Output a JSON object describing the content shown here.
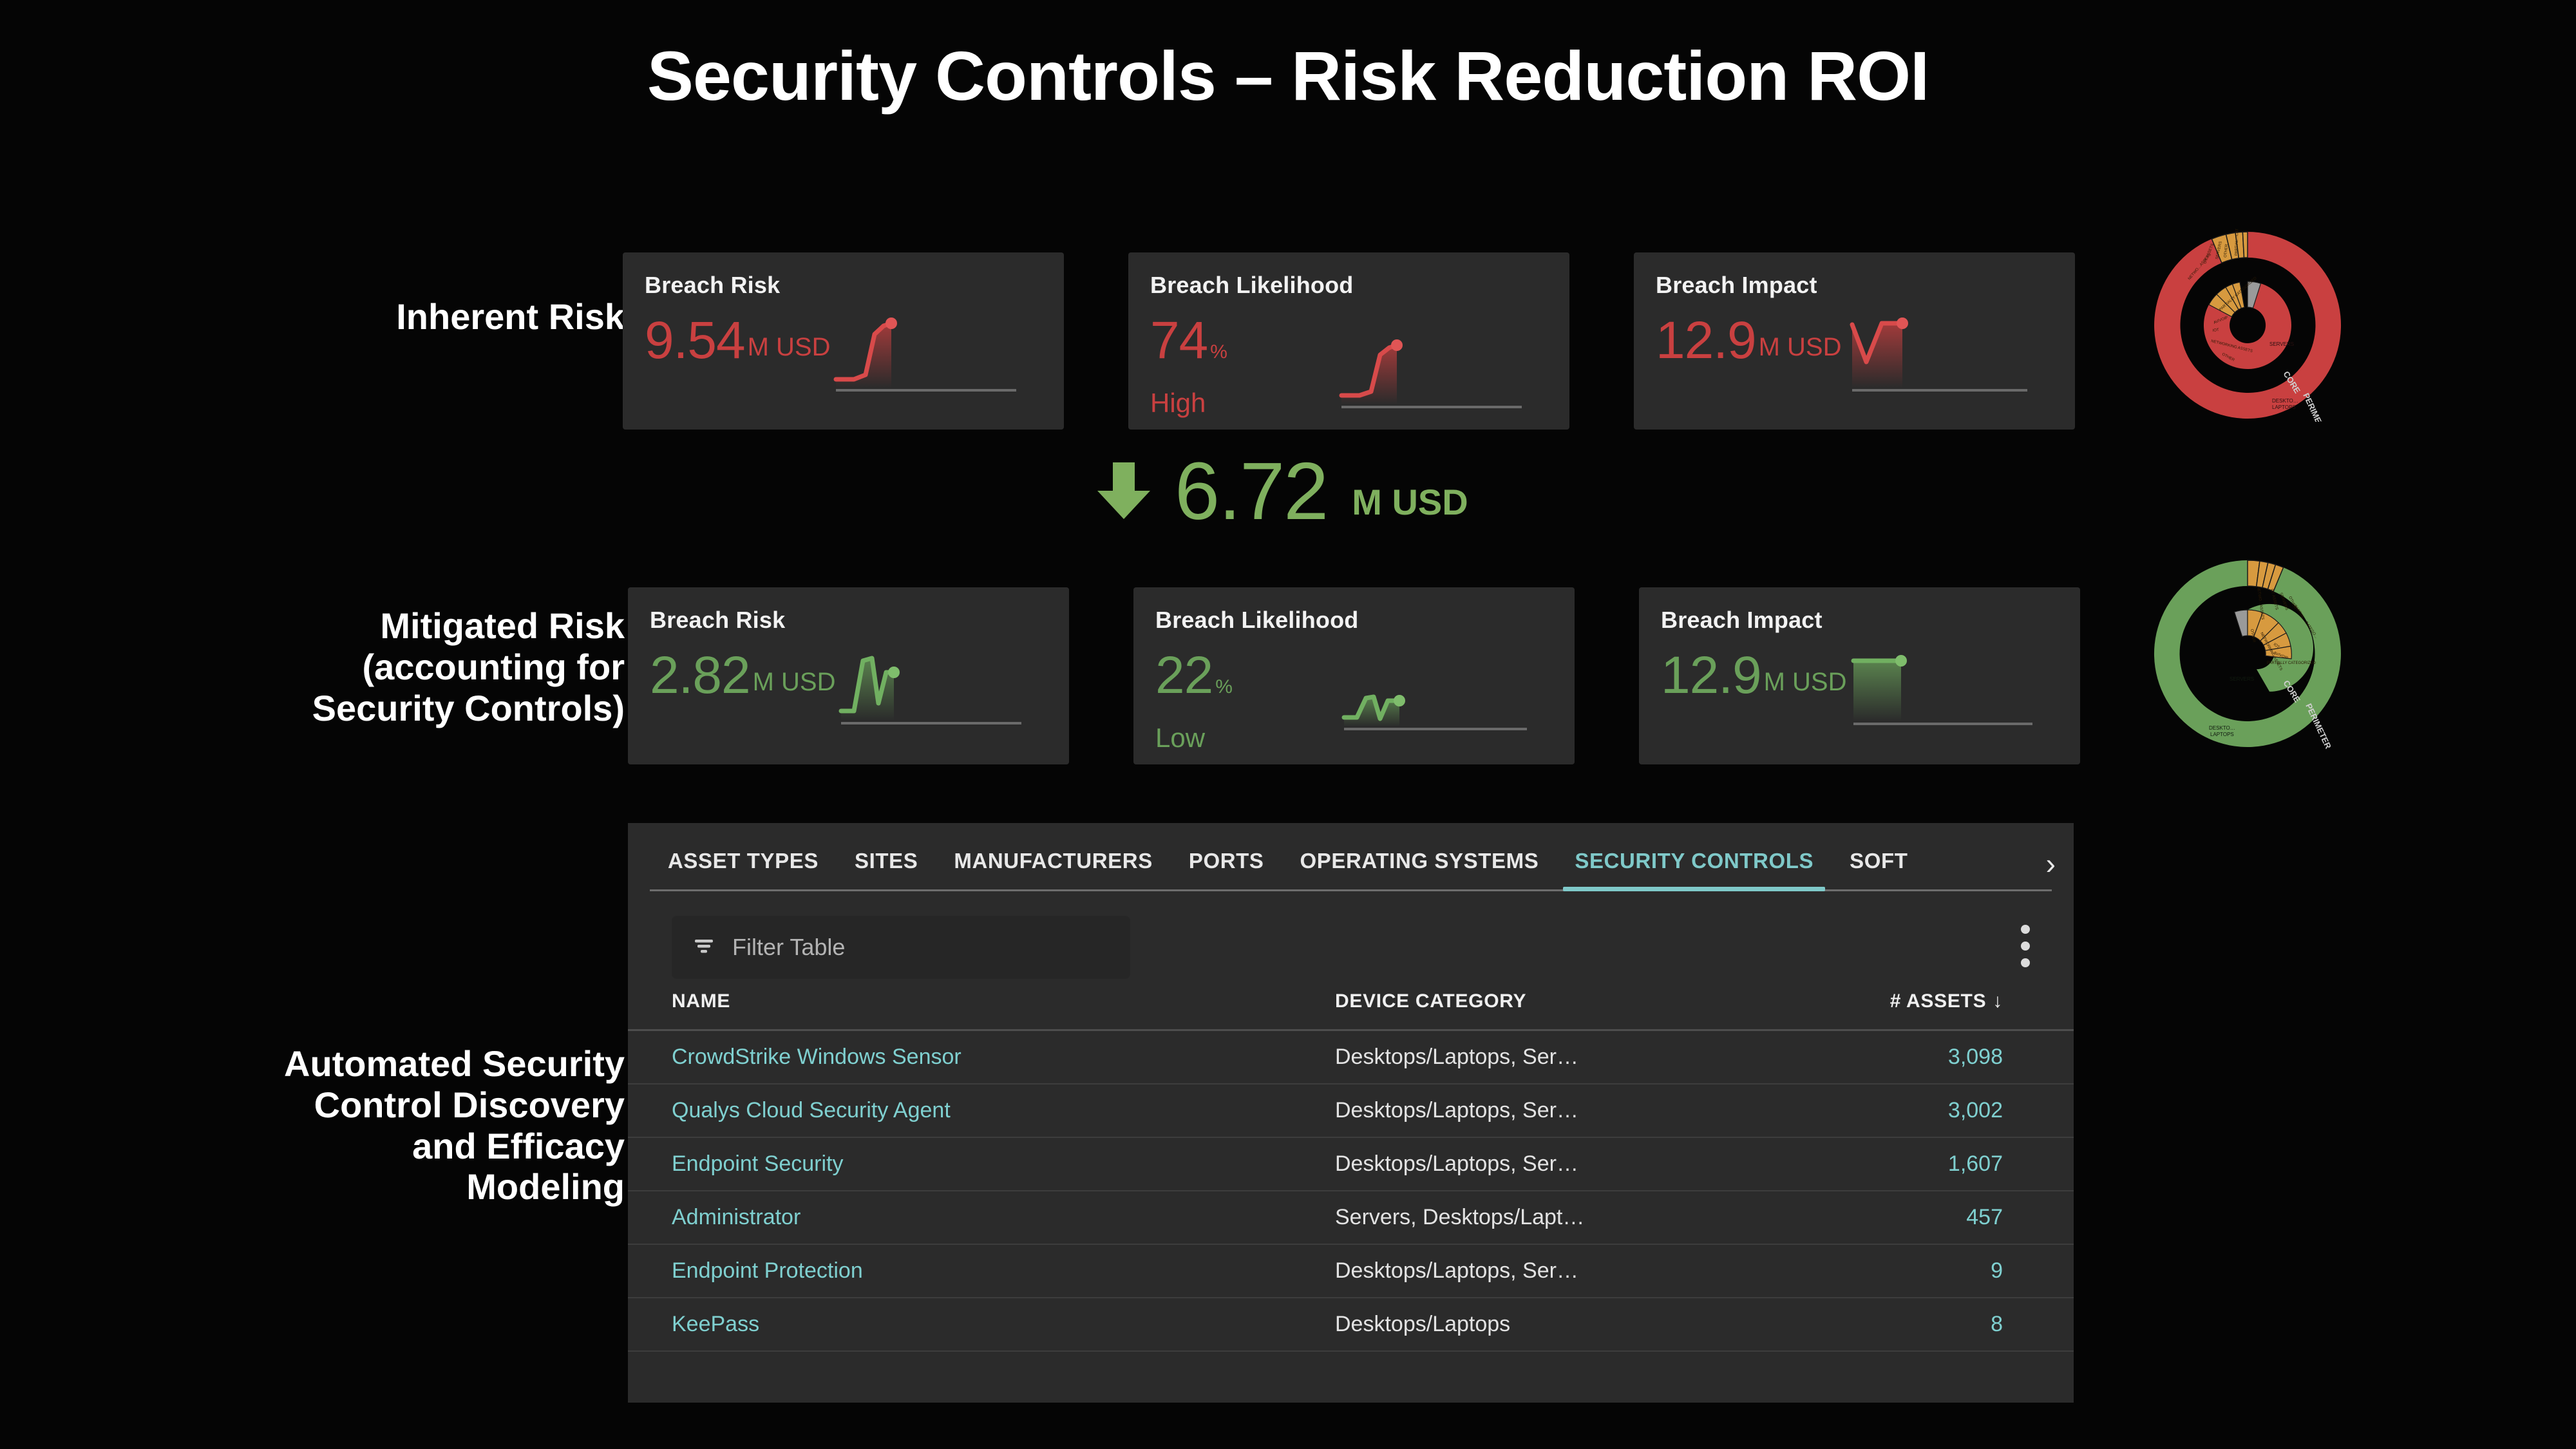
{
  "title": "Security Controls – Risk Reduction ROI",
  "rows_labels": {
    "inherent": "Inherent Risk",
    "mitigated": "Mitigated Risk\n(accounting for\nSecurity Controls)",
    "automated": "Automated Security\nControl Discovery\nand Efficacy\nModeling"
  },
  "colors": {
    "risk_red": "#c94040",
    "risk_green": "#6aa05a",
    "delta_green": "#7fb05e",
    "accent_teal": "#7fc9c9",
    "link_teal": "#7fd0d0",
    "card_bg": "#2b2b2b",
    "page_bg": "#050505",
    "donut_orange": "#d79a3f",
    "donut_grey": "#9a9a9a"
  },
  "inherent_cards": [
    {
      "title": "Breach Risk",
      "value": "9.54",
      "unit": "M USD",
      "unit_small": false,
      "sub": ""
    },
    {
      "title": "Breach Likelihood",
      "value": "74",
      "unit": "%",
      "unit_small": true,
      "sub": "High"
    },
    {
      "title": "Breach Impact",
      "value": "12.9",
      "unit": "M USD",
      "unit_small": false,
      "sub": ""
    }
  ],
  "mitigated_cards": [
    {
      "title": "Breach Risk",
      "value": "2.82",
      "unit": "M USD",
      "unit_small": false,
      "sub": ""
    },
    {
      "title": "Breach Likelihood",
      "value": "22",
      "unit": "%",
      "unit_small": true,
      "sub": "Low"
    },
    {
      "title": "Breach Impact",
      "value": "12.9",
      "unit": "M USD",
      "unit_small": false,
      "sub": ""
    }
  ],
  "delta": {
    "direction": "down",
    "value": "6.72",
    "unit": "M USD"
  },
  "table_panel": {
    "tabs": [
      {
        "label": "ASSET TYPES",
        "active": false
      },
      {
        "label": "SITES",
        "active": false
      },
      {
        "label": "MANUFACTURERS",
        "active": false
      },
      {
        "label": "PORTS",
        "active": false
      },
      {
        "label": "OPERATING SYSTEMS",
        "active": false
      },
      {
        "label": "SECURITY CONTROLS",
        "active": true
      },
      {
        "label": "SOFT",
        "active": false
      }
    ],
    "next_tab_icon": "›",
    "filter_placeholder": "Filter Table",
    "menu_icon": "kebab-menu-icon",
    "columns": [
      "NAME",
      "DEVICE CATEGORY",
      "# ASSETS"
    ],
    "sort": {
      "column": "# ASSETS",
      "direction": "desc",
      "glyph": "↓"
    },
    "rows": [
      {
        "name": "CrowdStrike Windows Sensor",
        "category": "Desktops/Laptops, Ser…",
        "assets": "3,098"
      },
      {
        "name": "Qualys Cloud Security Agent",
        "category": "Desktops/Laptops, Ser…",
        "assets": "3,002"
      },
      {
        "name": "Endpoint Security",
        "category": "Desktops/Laptops, Ser…",
        "assets": "1,607"
      },
      {
        "name": "Administrator",
        "category": "Servers, Desktops/Lapt…",
        "assets": "457"
      },
      {
        "name": "Endpoint Protection",
        "category": "Desktops/Laptops, Ser…",
        "assets": "9"
      },
      {
        "name": "KeePass",
        "category": "Desktops/Laptops",
        "assets": "8"
      }
    ]
  },
  "chart_data": [
    {
      "type": "pie",
      "name": "inherent-risk-sunburst",
      "title": "",
      "ring_labels": [
        "CORE",
        "PERIMETER"
      ],
      "rings": [
        {
          "name": "CORE",
          "slices": [
            {
              "label": "SERVERS",
              "value": 62,
              "color": "#c94040"
            },
            {
              "label": "OTHER",
              "value": 7,
              "color": "#d79a3f"
            },
            {
              "label": "NETWORKING ASSETS",
              "value": 9,
              "color": "#d79a3f"
            },
            {
              "label": "IOT",
              "value": 5,
              "color": "#d79a3f"
            },
            {
              "label": "AV/VOIP",
              "value": 4,
              "color": "#d79a3f"
            },
            {
              "label": "PARTIALLY CATEGORIZED",
              "value": 6,
              "color": "#d79a3f"
            },
            {
              "label": "",
              "value": 7,
              "color": "#9a9a9a"
            }
          ]
        },
        {
          "name": "PERIMETER",
          "slices": [
            {
              "label": "SERVERS",
              "value": 44,
              "color": "#c94040"
            },
            {
              "label": "DESKTOPS/LAPTOPS",
              "value": 34,
              "color": "#c94040"
            },
            {
              "label": "NETWO… ASSETS",
              "value": 6,
              "color": "#d79a3f"
            },
            {
              "label": "OT ASSETS",
              "value": 4,
              "color": "#d79a3f"
            },
            {
              "label": "SERVERS",
              "value": 4,
              "color": "#d79a3f"
            },
            {
              "label": "OTHER",
              "value": 3,
              "color": "#d79a3f"
            },
            {
              "label": "PARTIAL… CATEGO…",
              "value": 5,
              "color": "#d79a3f"
            }
          ]
        }
      ]
    },
    {
      "type": "pie",
      "name": "mitigated-risk-sunburst",
      "title": "",
      "ring_labels": [
        "CORE",
        "PERIMETER"
      ],
      "rings": [
        {
          "name": "CORE",
          "slices": [
            {
              "label": "SERVERS",
              "value": 62,
              "color": "#6aa05a"
            },
            {
              "label": "OTHER",
              "value": 5,
              "color": "#d79a3f"
            },
            {
              "label": "NETWORKING ASSETS",
              "value": 8,
              "color": "#d79a3f"
            },
            {
              "label": "IOT",
              "value": 5,
              "color": "#d79a3f"
            },
            {
              "label": "AV/VOIP",
              "value": 5,
              "color": "#d79a3f"
            },
            {
              "label": "PARTIALLY CATEGORIZED",
              "value": 7,
              "color": "#d79a3f"
            },
            {
              "label": "",
              "value": 8,
              "color": "#9a9a9a"
            }
          ]
        },
        {
          "name": "PERIMETER",
          "slices": [
            {
              "label": "NETWO… ASSETS",
              "value": 6,
              "color": "#d79a3f"
            },
            {
              "label": "OT ASSETS",
              "value": 4,
              "color": "#d79a3f"
            },
            {
              "label": "SERVERS",
              "value": 4,
              "color": "#d79a3f"
            },
            {
              "label": "OTHER",
              "value": 3,
              "color": "#d79a3f"
            },
            {
              "label": "PARTIAL… CATEGO…",
              "value": 5,
              "color": "#d79a3f"
            },
            {
              "label": "SERVERS",
              "value": 44,
              "color": "#6aa05a"
            },
            {
              "label": "DESKTOPS/LAPTOPS",
              "value": 34,
              "color": "#6aa05a"
            }
          ]
        }
      ]
    },
    {
      "type": "line",
      "name": "inherent-breach-risk-sparkline",
      "values": [
        10,
        10,
        10,
        75,
        92,
        95
      ],
      "color": "#c94040"
    },
    {
      "type": "line",
      "name": "inherent-breach-likelihood-sparkline",
      "values": [
        10,
        10,
        10,
        72,
        90,
        92
      ],
      "color": "#c94040"
    },
    {
      "type": "line",
      "name": "inherent-breach-impact-sparkline",
      "values": [
        95,
        40,
        90,
        95
      ],
      "color": "#c94040"
    },
    {
      "type": "line",
      "name": "mitigated-breach-risk-sparkline",
      "values": [
        12,
        12,
        85,
        95,
        30,
        70,
        70
      ],
      "color": "#6aa05a"
    },
    {
      "type": "line",
      "name": "mitigated-breach-likelihood-sparkline",
      "values": [
        15,
        15,
        55,
        60,
        18,
        52,
        52
      ],
      "color": "#6aa05a"
    },
    {
      "type": "line",
      "name": "mitigated-breach-impact-sparkline",
      "values": [
        95,
        95,
        95,
        95
      ],
      "color": "#6aa05a"
    }
  ]
}
